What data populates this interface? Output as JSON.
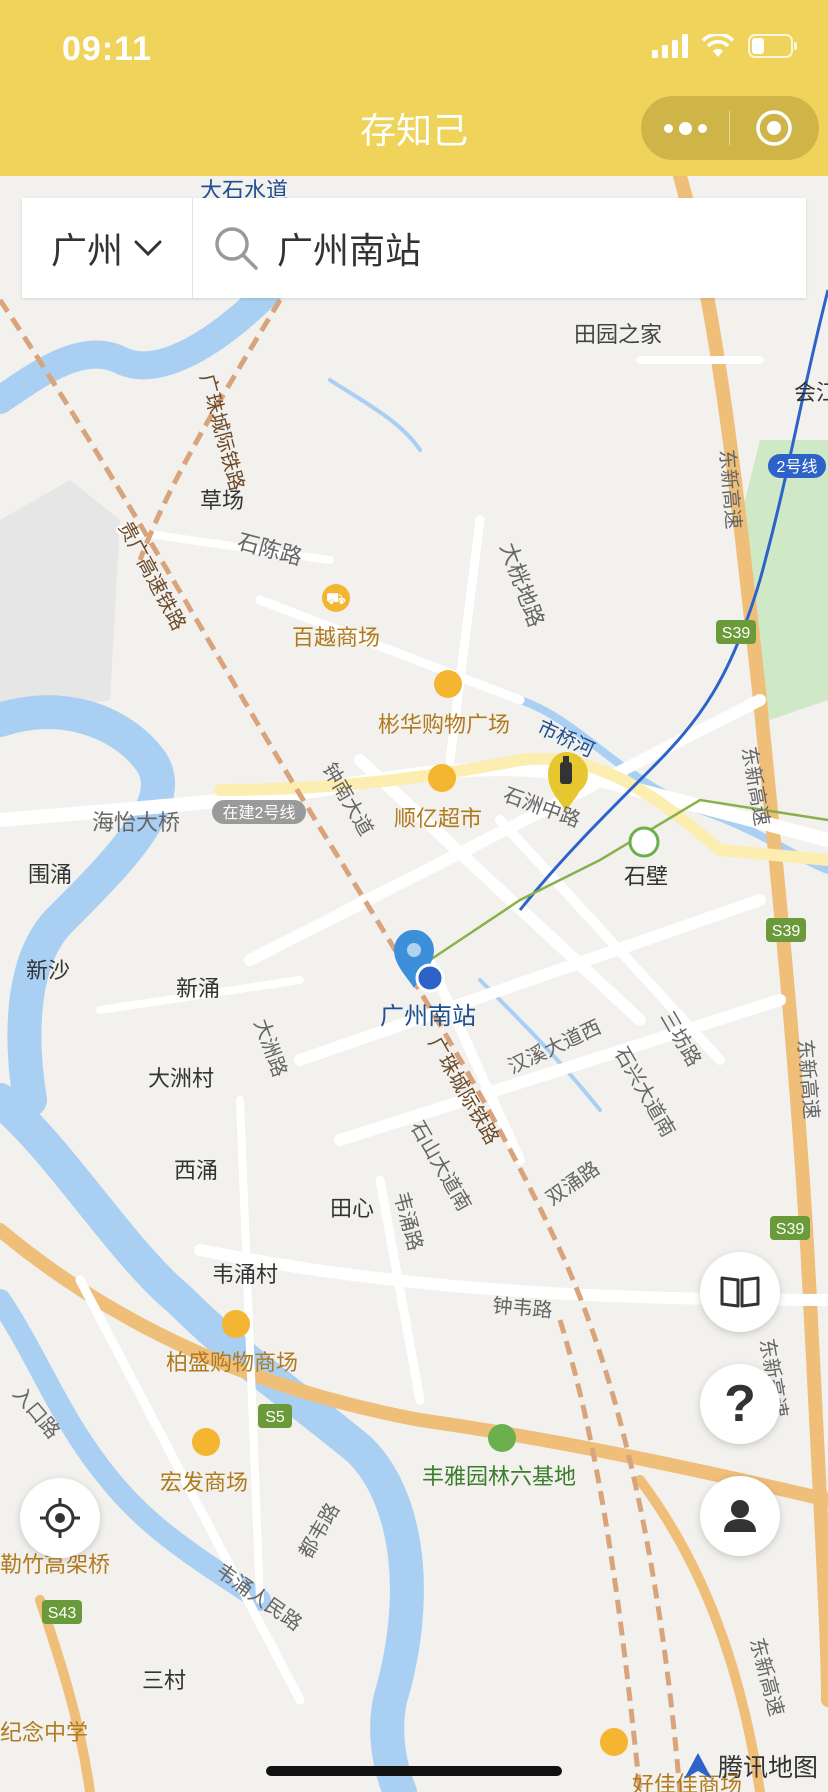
{
  "status_bar": {
    "time": "09:11"
  },
  "app_header": {
    "title": "存知己"
  },
  "search": {
    "city": "广州",
    "query": "广州南站"
  },
  "map": {
    "place_labels": [
      "大石水道",
      "田园之家",
      "会江",
      "草场",
      "石陈路",
      "百越商场",
      "大桄地路",
      "彬华购物广场",
      "市桥河",
      "钟南大道",
      "石洲中路",
      "顺亿超市",
      "石壁",
      "海怡大桥",
      "围涌",
      "新沙",
      "新涌",
      "大洲村",
      "大洲路",
      "广州南站",
      "汉溪大道西",
      "三坊路",
      "石兴大道南",
      "广珠城际铁路",
      "石山大道南",
      "西涌",
      "田心",
      "韦涌路",
      "双涌路",
      "韦涌村",
      "钟韦路",
      "柏盛购物商场",
      "丰雅园林六基地",
      "宏发商场",
      "都韦路",
      "韦涌人民路",
      "勒竹高架桥",
      "三村",
      "纪念中学",
      "好佳佳商场",
      "广珠城际铁路",
      "贵广高速铁路",
      "东新高速",
      "东新高速",
      "东新高速",
      "东新高速",
      "东新高速",
      "入口路"
    ],
    "road_badges": {
      "metro_line": "2号线",
      "metro_building": "在建2号线",
      "s39": "S39",
      "s5": "S5",
      "s43": "S43"
    },
    "watermark": "腾讯地图"
  },
  "colors": {
    "header": "#efd35b",
    "water": "#a9cff2",
    "highway": "#f2bd73",
    "metro": "#2d63c9",
    "green": "#cfe8c5"
  }
}
